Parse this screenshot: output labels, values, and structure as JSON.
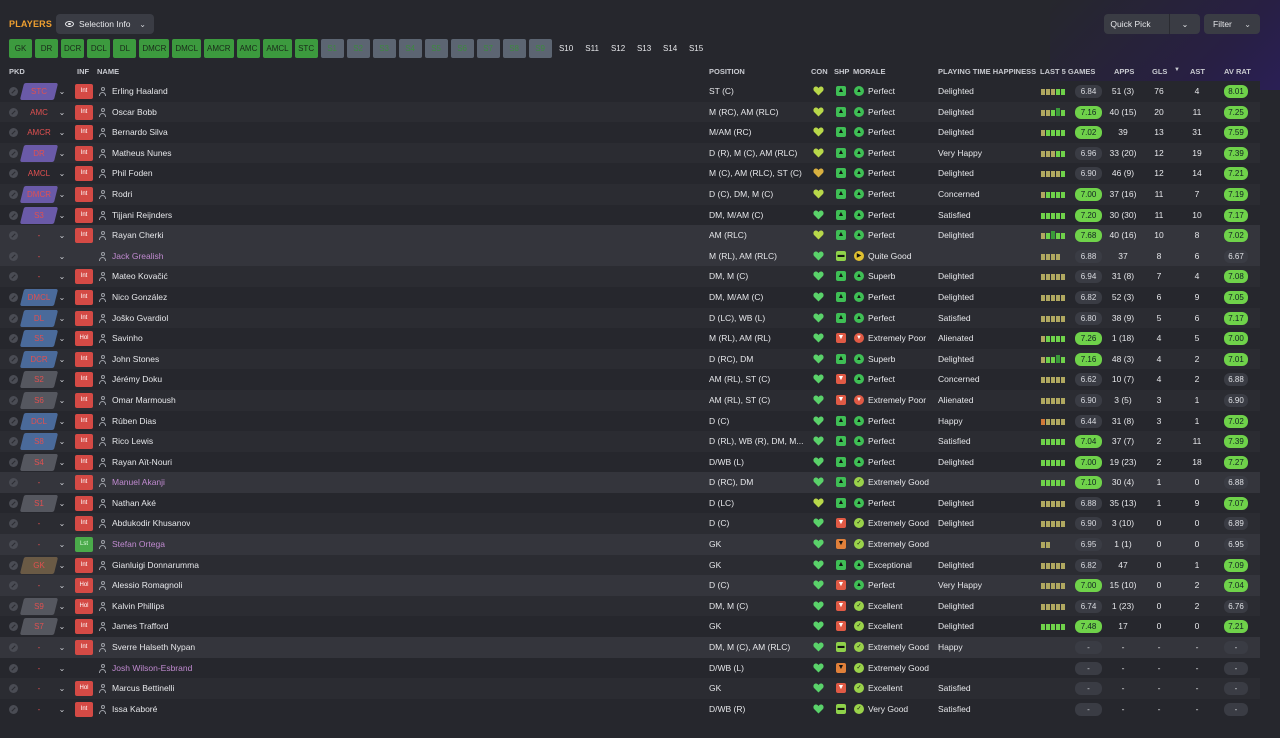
{
  "header": {
    "title": "PLAYERS",
    "selection_info": "Selection Info",
    "quick_pick": "Quick Pick",
    "filter": "Filter"
  },
  "position_tabs": [
    {
      "label": "GK",
      "style": "green"
    },
    {
      "label": "DR",
      "style": "green"
    },
    {
      "label": "DCR",
      "style": "green"
    },
    {
      "label": "DCL",
      "style": "green"
    },
    {
      "label": "DL",
      "style": "green"
    },
    {
      "label": "DMCR",
      "style": "green"
    },
    {
      "label": "DMCL",
      "style": "green"
    },
    {
      "label": "AMCR",
      "style": "green"
    },
    {
      "label": "AMC",
      "style": "green"
    },
    {
      "label": "AMCL",
      "style": "green"
    },
    {
      "label": "STC",
      "style": "green"
    },
    {
      "label": "S1",
      "style": "grey"
    },
    {
      "label": "S2",
      "style": "grey"
    },
    {
      "label": "S3",
      "style": "grey"
    },
    {
      "label": "S4",
      "style": "grey"
    },
    {
      "label": "S5",
      "style": "grey"
    },
    {
      "label": "S6",
      "style": "grey"
    },
    {
      "label": "S7",
      "style": "grey"
    },
    {
      "label": "S8",
      "style": "grey"
    },
    {
      "label": "S9",
      "style": "grey"
    },
    {
      "label": "S10",
      "style": "plain"
    },
    {
      "label": "S11",
      "style": "plain"
    },
    {
      "label": "S12",
      "style": "plain"
    },
    {
      "label": "S13",
      "style": "plain"
    },
    {
      "label": "S14",
      "style": "plain"
    },
    {
      "label": "S15",
      "style": "plain"
    }
  ],
  "columns": {
    "pkd": "PKD",
    "inf": "INF",
    "name": "NAME",
    "position": "POSITION",
    "con": "CON",
    "shp": "SHP",
    "morale": "MORALE",
    "pth": "PLAYING TIME HAPPINESS",
    "last5": "LAST 5 GAMES",
    "apps": "APPS",
    "gls": "GLS",
    "ast": "AST",
    "avrat": "AV RAT",
    "sort_icon": "▼"
  },
  "players": [
    {
      "pkd": "STC",
      "pkd_style": "purple",
      "inf": "Int",
      "name": "Erling Haaland",
      "loan": false,
      "position": "ST (C)",
      "con": "lime",
      "shp": "green",
      "morale_icon": "green",
      "morale": "Perfect",
      "pth": "Delighted",
      "bars": "yyygg",
      "last5": "6.84",
      "last5_style": "plain",
      "apps": "51 (3)",
      "gls": "76",
      "ast": "4",
      "avrat": "8.01",
      "avrat_style": "green"
    },
    {
      "pkd": "AMC",
      "pkd_style": "dark",
      "inf": "Int",
      "name": "Oscar Bobb",
      "loan": false,
      "position": "M (RC), AM (RLC)",
      "con": "lime",
      "shp": "green",
      "morale_icon": "green",
      "morale": "Perfect",
      "pth": "Delighted",
      "bars": "yygGg",
      "last5": "7.16",
      "last5_style": "green",
      "apps": "40 (15)",
      "gls": "20",
      "ast": "11",
      "avrat": "7.25",
      "avrat_style": "green"
    },
    {
      "pkd": "AMCR",
      "pkd_style": "dark",
      "inf": "Int",
      "name": "Bernardo Silva",
      "loan": false,
      "position": "M/AM (RC)",
      "con": "lime",
      "shp": "green",
      "morale_icon": "green",
      "morale": "Perfect",
      "pth": "Delighted",
      "bars": "ygggg",
      "last5": "7.02",
      "last5_style": "green",
      "apps": "39",
      "gls": "13",
      "ast": "31",
      "avrat": "7.59",
      "avrat_style": "green"
    },
    {
      "pkd": "DR",
      "pkd_style": "purple",
      "inf": "Int",
      "name": "Matheus Nunes",
      "loan": false,
      "position": "D (R), M (C), AM (RLC)",
      "con": "lime",
      "shp": "green",
      "morale_icon": "green",
      "morale": "Perfect",
      "pth": "Very Happy",
      "bars": "yyygg",
      "last5": "6.96",
      "last5_style": "plain",
      "apps": "33 (20)",
      "gls": "12",
      "ast": "19",
      "avrat": "7.39",
      "avrat_style": "green"
    },
    {
      "pkd": "AMCL",
      "pkd_style": "dark",
      "inf": "Int",
      "name": "Phil Foden",
      "loan": false,
      "position": "M (C), AM (RLC), ST (C)",
      "con": "yellow",
      "shp": "green",
      "morale_icon": "green",
      "morale": "Perfect",
      "pth": "Delighted",
      "bars": "yyyyg",
      "last5": "6.90",
      "last5_style": "plain",
      "apps": "46 (9)",
      "gls": "12",
      "ast": "14",
      "avrat": "7.21",
      "avrat_style": "green"
    },
    {
      "pkd": "DMCR",
      "pkd_style": "purple",
      "inf": "Int",
      "name": "Rodri",
      "loan": false,
      "position": "D (C), DM, M (C)",
      "con": "lime",
      "shp": "green",
      "morale_icon": "green",
      "morale": "Perfect",
      "pth": "Concerned",
      "bars": "ygggg",
      "last5": "7.00",
      "last5_style": "green",
      "apps": "37 (16)",
      "gls": "11",
      "ast": "7",
      "avrat": "7.19",
      "avrat_style": "green"
    },
    {
      "pkd": "S3",
      "pkd_style": "purple",
      "inf": "Int",
      "name": "Tijjani Reijnders",
      "loan": false,
      "position": "DM, M/AM (C)",
      "con": "green",
      "shp": "green",
      "morale_icon": "green",
      "morale": "Perfect",
      "pth": "Satisfied",
      "bars": "ggggg",
      "last5": "7.20",
      "last5_style": "green",
      "apps": "30 (30)",
      "gls": "11",
      "ast": "10",
      "avrat": "7.17",
      "avrat_style": "green"
    },
    {
      "pkd": "-",
      "pkd_style": "dark",
      "inf": "Int",
      "name": "Rayan Cherki",
      "loan": false,
      "position": "AM (RLC)",
      "con": "lime",
      "shp": "green",
      "morale_icon": "green",
      "morale": "Perfect",
      "pth": "Delighted",
      "bars": "ygGgg",
      "last5": "7.68",
      "last5_style": "green",
      "apps": "40 (16)",
      "gls": "10",
      "ast": "8",
      "avrat": "7.02",
      "avrat_style": "green",
      "highlight": true
    },
    {
      "pkd": "-",
      "pkd_style": "dark",
      "inf": "",
      "name": "Jack Grealish",
      "loan": true,
      "position": "M (RL), AM (RLC)",
      "con": "green",
      "shp": "lime",
      "morale_icon": "yellow",
      "morale": "Quite Good",
      "pth": "",
      "bars": "yyyy",
      "last5": "6.88",
      "last5_style": "plain",
      "apps": "37",
      "gls": "8",
      "ast": "6",
      "avrat": "6.67",
      "avrat_style": "plain",
      "highlight": true
    },
    {
      "pkd": "-",
      "pkd_style": "dark",
      "inf": "Int",
      "name": "Mateo Kovačić",
      "loan": false,
      "position": "DM, M (C)",
      "con": "green",
      "shp": "green",
      "morale_icon": "green",
      "morale": "Superb",
      "pth": "Delighted",
      "bars": "yyyyy",
      "last5": "6.94",
      "last5_style": "plain",
      "apps": "31 (8)",
      "gls": "7",
      "ast": "4",
      "avrat": "7.08",
      "avrat_style": "green"
    },
    {
      "pkd": "DMCL",
      "pkd_style": "blue",
      "inf": "Int",
      "name": "Nico González",
      "loan": false,
      "position": "DM, M/AM (C)",
      "con": "green",
      "shp": "green",
      "morale_icon": "green",
      "morale": "Perfect",
      "pth": "Delighted",
      "bars": "yyyyy",
      "last5": "6.82",
      "last5_style": "plain",
      "apps": "52 (3)",
      "gls": "6",
      "ast": "9",
      "avrat": "7.05",
      "avrat_style": "green"
    },
    {
      "pkd": "DL",
      "pkd_style": "blue",
      "inf": "Int",
      "name": "Joško Gvardiol",
      "loan": false,
      "position": "D (LC), WB (L)",
      "con": "green",
      "shp": "green",
      "morale_icon": "green",
      "morale": "Perfect",
      "pth": "Satisfied",
      "bars": "yyyyy",
      "last5": "6.80",
      "last5_style": "plain",
      "apps": "38 (9)",
      "gls": "5",
      "ast": "6",
      "avrat": "7.17",
      "avrat_style": "green"
    },
    {
      "pkd": "S5",
      "pkd_style": "blue",
      "inf": "Hol",
      "name": "Savinho",
      "loan": false,
      "position": "M (RL), AM (RL)",
      "con": "green",
      "shp": "red",
      "morale_icon": "red",
      "morale": "Extremely Poor",
      "pth": "Alienated",
      "bars": "ygggg",
      "last5": "7.26",
      "last5_style": "green",
      "apps": "1 (18)",
      "gls": "4",
      "ast": "5",
      "avrat": "7.00",
      "avrat_style": "green"
    },
    {
      "pkd": "DCR",
      "pkd_style": "blue",
      "inf": "Int",
      "name": "John Stones",
      "loan": false,
      "position": "D (RC), DM",
      "con": "green",
      "shp": "green",
      "morale_icon": "green",
      "morale": "Superb",
      "pth": "Delighted",
      "bars": "yggGg",
      "last5": "7.16",
      "last5_style": "green",
      "apps": "48 (3)",
      "gls": "4",
      "ast": "2",
      "avrat": "7.01",
      "avrat_style": "green"
    },
    {
      "pkd": "S2",
      "pkd_style": "grey",
      "inf": "Int",
      "name": "Jérémy Doku",
      "loan": false,
      "position": "AM (RL), ST (C)",
      "con": "green",
      "shp": "red",
      "morale_icon": "green",
      "morale": "Perfect",
      "pth": "Concerned",
      "bars": "yyyyy",
      "last5": "6.62",
      "last5_style": "plain",
      "apps": "10 (7)",
      "gls": "4",
      "ast": "2",
      "avrat": "6.88",
      "avrat_style": "plain"
    },
    {
      "pkd": "S6",
      "pkd_style": "grey",
      "inf": "Int",
      "name": "Omar Marmoush",
      "loan": false,
      "position": "AM (RL), ST (C)",
      "con": "green",
      "shp": "red",
      "morale_icon": "red",
      "morale": "Extremely Poor",
      "pth": "Alienated",
      "bars": "yyyyy",
      "last5": "6.90",
      "last5_style": "plain",
      "apps": "3 (5)",
      "gls": "3",
      "ast": "1",
      "avrat": "6.90",
      "avrat_style": "plain"
    },
    {
      "pkd": "DCL",
      "pkd_style": "blue",
      "inf": "Int",
      "name": "Rúben Dias",
      "loan": false,
      "position": "D (C)",
      "con": "green",
      "shp": "green",
      "morale_icon": "green",
      "morale": "Perfect",
      "pth": "Happy",
      "bars": "oyyyy",
      "last5": "6.44",
      "last5_style": "plain",
      "apps": "31 (8)",
      "gls": "3",
      "ast": "1",
      "avrat": "7.02",
      "avrat_style": "green"
    },
    {
      "pkd": "S8",
      "pkd_style": "blue",
      "inf": "Int",
      "name": "Rico Lewis",
      "loan": false,
      "position": "D (RL), WB (R), DM, M...",
      "con": "green",
      "shp": "green",
      "morale_icon": "green",
      "morale": "Perfect",
      "pth": "Satisfied",
      "bars": "ggggg",
      "last5": "7.04",
      "last5_style": "green",
      "apps": "37 (7)",
      "gls": "2",
      "ast": "11",
      "avrat": "7.39",
      "avrat_style": "green"
    },
    {
      "pkd": "S4",
      "pkd_style": "grey",
      "inf": "Int",
      "name": "Rayan Aït-Nouri",
      "loan": false,
      "position": "D/WB (L)",
      "con": "green",
      "shp": "green",
      "morale_icon": "green",
      "morale": "Perfect",
      "pth": "Delighted",
      "bars": "ggggg",
      "last5": "7.00",
      "last5_style": "green",
      "apps": "19 (23)",
      "gls": "2",
      "ast": "18",
      "avrat": "7.27",
      "avrat_style": "green"
    },
    {
      "pkd": "-",
      "pkd_style": "dark",
      "inf": "Int",
      "name": "Manuel Akanji",
      "loan": true,
      "position": "D (RC), DM",
      "con": "green",
      "shp": "green",
      "morale_icon": "lime",
      "morale": "Extremely Good",
      "pth": "",
      "bars": "ggggg",
      "last5": "7.10",
      "last5_style": "green",
      "apps": "30 (4)",
      "gls": "1",
      "ast": "0",
      "avrat": "6.88",
      "avrat_style": "plain",
      "highlight": true
    },
    {
      "pkd": "S1",
      "pkd_style": "grey",
      "inf": "Int",
      "name": "Nathan Aké",
      "loan": false,
      "position": "D (LC)",
      "con": "lime",
      "shp": "green",
      "morale_icon": "green",
      "morale": "Perfect",
      "pth": "Delighted",
      "bars": "yyyyy",
      "last5": "6.88",
      "last5_style": "plain",
      "apps": "35 (13)",
      "gls": "1",
      "ast": "9",
      "avrat": "7.07",
      "avrat_style": "green"
    },
    {
      "pkd": "-",
      "pkd_style": "dark",
      "inf": "Int",
      "name": "Abdukodir Khusanov",
      "loan": false,
      "position": "D (C)",
      "con": "green",
      "shp": "red",
      "morale_icon": "lime",
      "morale": "Extremely Good",
      "pth": "Delighted",
      "bars": "yyyyy",
      "last5": "6.90",
      "last5_style": "plain",
      "apps": "3 (10)",
      "gls": "0",
      "ast": "0",
      "avrat": "6.89",
      "avrat_style": "plain"
    },
    {
      "pkd": "-",
      "pkd_style": "dark",
      "inf": "Lst",
      "name": "Stefan Ortega",
      "loan": true,
      "position": "GK",
      "con": "green",
      "shp": "orange",
      "morale_icon": "lime",
      "morale": "Extremely Good",
      "pth": "",
      "bars": "yy",
      "last5": "6.95",
      "last5_style": "plain",
      "apps": "1 (1)",
      "gls": "0",
      "ast": "0",
      "avrat": "6.95",
      "avrat_style": "plain",
      "highlight": true
    },
    {
      "pkd": "GK",
      "pkd_style": "brown",
      "inf": "Int",
      "name": "Gianluigi Donnarumma",
      "loan": false,
      "position": "GK",
      "con": "green",
      "shp": "green",
      "morale_icon": "green",
      "morale": "Exceptional",
      "pth": "Delighted",
      "bars": "yyyyy",
      "last5": "6.82",
      "last5_style": "plain",
      "apps": "47",
      "gls": "0",
      "ast": "1",
      "avrat": "7.09",
      "avrat_style": "green"
    },
    {
      "pkd": "-",
      "pkd_style": "dark",
      "inf": "Hol",
      "name": "Alessio Romagnoli",
      "loan": false,
      "position": "D (C)",
      "con": "green",
      "shp": "red",
      "morale_icon": "green",
      "morale": "Perfect",
      "pth": "Very Happy",
      "bars": "yyyyy",
      "last5": "7.00",
      "last5_style": "green",
      "apps": "15 (10)",
      "gls": "0",
      "ast": "2",
      "avrat": "7.04",
      "avrat_style": "green",
      "highlight": true
    },
    {
      "pkd": "S9",
      "pkd_style": "grey",
      "inf": "Hol",
      "name": "Kalvin Phillips",
      "loan": false,
      "position": "DM, M (C)",
      "con": "green",
      "shp": "red",
      "morale_icon": "lime",
      "morale": "Excellent",
      "pth": "Delighted",
      "bars": "yyyyy",
      "last5": "6.74",
      "last5_style": "plain",
      "apps": "1 (23)",
      "gls": "0",
      "ast": "2",
      "avrat": "6.76",
      "avrat_style": "plain"
    },
    {
      "pkd": "S7",
      "pkd_style": "grey",
      "inf": "Int",
      "name": "James Trafford",
      "loan": false,
      "position": "GK",
      "con": "green",
      "shp": "red",
      "morale_icon": "lime",
      "morale": "Excellent",
      "pth": "Delighted",
      "bars": "ggggg",
      "last5": "7.48",
      "last5_style": "green",
      "apps": "17",
      "gls": "0",
      "ast": "0",
      "avrat": "7.21",
      "avrat_style": "green"
    },
    {
      "pkd": "-",
      "pkd_style": "dark",
      "inf": "Int",
      "name": "Sverre Halseth Nypan",
      "loan": false,
      "position": "DM, M (C), AM (RLC)",
      "con": "green",
      "shp": "lime",
      "morale_icon": "lime",
      "morale": "Extremely Good",
      "pth": "Happy",
      "bars": "",
      "last5": "-",
      "last5_style": "dash",
      "apps": "-",
      "gls": "-",
      "ast": "-",
      "avrat": "-",
      "avrat_style": "dash",
      "highlight": true
    },
    {
      "pkd": "-",
      "pkd_style": "dark",
      "inf": "",
      "name": "Josh Wilson-Esbrand",
      "loan": true,
      "position": "D/WB (L)",
      "con": "green",
      "shp": "orange",
      "morale_icon": "lime",
      "morale": "Extremely Good",
      "pth": "",
      "bars": "",
      "last5": "-",
      "last5_style": "dash",
      "apps": "-",
      "gls": "-",
      "ast": "-",
      "avrat": "-",
      "avrat_style": "dash"
    },
    {
      "pkd": "-",
      "pkd_style": "dark",
      "inf": "Hol",
      "name": "Marcus Bettinelli",
      "loan": false,
      "position": "GK",
      "con": "green",
      "shp": "red",
      "morale_icon": "lime",
      "morale": "Excellent",
      "pth": "Satisfied",
      "bars": "",
      "last5": "-",
      "last5_style": "dash",
      "apps": "-",
      "gls": "-",
      "ast": "-",
      "avrat": "-",
      "avrat_style": "dash"
    },
    {
      "pkd": "-",
      "pkd_style": "dark",
      "inf": "Int",
      "name": "Issa Kaboré",
      "loan": false,
      "position": "D/WB (R)",
      "con": "green",
      "shp": "lime",
      "morale_icon": "lime",
      "morale": "Very Good",
      "pth": "Satisfied",
      "bars": "",
      "last5": "-",
      "last5_style": "dash",
      "apps": "-",
      "gls": "-",
      "ast": "-",
      "avrat": "-",
      "avrat_style": "dash"
    }
  ]
}
